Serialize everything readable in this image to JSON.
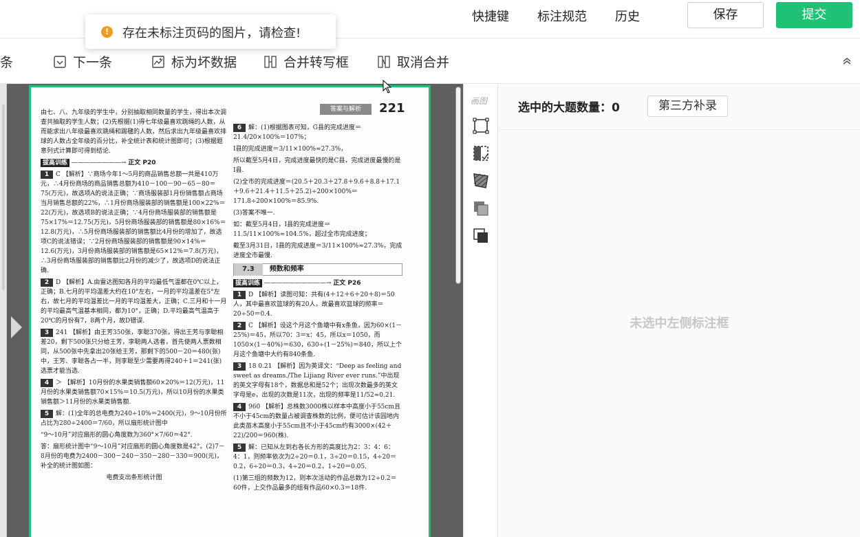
{
  "topbar": {
    "links": [
      "快捷键",
      "标注规范",
      "历史"
    ],
    "save_label": "保存",
    "submit_label": "提交",
    "accent": "#1fc274"
  },
  "toast": {
    "text": "存在未标注页码的图片，请检查!",
    "icon": "warning-icon",
    "color": "#f59a1b"
  },
  "toolbar": {
    "items": [
      {
        "label": "条",
        "icon": ""
      },
      {
        "label": "下一条",
        "icon": "checkbox-icon"
      },
      {
        "label": "标为坏数据",
        "icon": "image-bad-icon"
      },
      {
        "label": "合并转写框",
        "icon": "merge-icon"
      },
      {
        "label": "取消合并",
        "icon": "unmerge-icon"
      }
    ]
  },
  "document": {
    "header_tag": "答案与解析",
    "page_number": "221",
    "left_col": [
      "由七、八、九年级的学生中，分别抽取相同数量的学生，得出本次调查共抽取的学生人数；(2)先根据(1)得七年级最喜欢跳绳的人数，从而能求出八年级最喜欢跳绳和踢毽的人数，然后求出九年级最喜欢排球的人数占全年级的百分比，补全统计表和统计图即可；(3)根据题意列式计算即可得到结论."
    ],
    "section_tag": "拔高训练",
    "section_ref": "正文 P20",
    "items_left": [
      {
        "n": "1",
        "text": "C 【解析】∵商场今年1～5月的商品销售总额一共是410万元，∴4月份商场的商品销售总额为410－100－90－65－80＝75(万元)，故选项A的说法正确；∵商场服装部1月份销售额占商场当月销售总额的22%，∴1月份商场服装部的销售额是100×22%＝22(万元)，故选项B的说法正确；∵4月份商场服装部的销售额是75×17%＝12.75(万元)，5月份商场服装部的销售额是80×16%＝12.8(万元)，∴5月份商场服装部的销售额比4月份的增加了，故选项C的说法错误；∵2月份商场服装部的销售额是90×14%＝12.6(万元)，3月份商场服装部的销售额是65×12%＝7.8(万元)，∴3月份商场服装部的销售额比2月份的减少了，故选项D的说法正确."
      },
      {
        "n": "2",
        "text": "D 【解析】A.由雷达图知各月的平均最低气温都在0℃以上，正确；B.七月的平均温差大约在10°左右，一月的平均温差在5°左右，故七月的平均温差比一月的平均温差大，正确；C.三月和十一月的平均最高气温基本相同，都为10°，正确；D.平均最高气温高于20℃的月份有7，8两个月，故D错误."
      },
      {
        "n": "3",
        "text": "241 【解析】由王芳350张，李聪370张，得出王芳与李聪相差20，剩下500张只分给王芳，李聪两人选者，首先使两人票数相同，从500张中先拿出20张给王芳，那剩下的500－20＝480(张)中，王芳、李聪各占一半，则李聪至少需要再得240＋1＝241(张)选票才能当选."
      },
      {
        "n": "4",
        "text": "＞ 【解析】10月份的水果类销售额60×20%＝12(万元)，11月份的水果类销售额70×15%＝10.5(万元)，所以10月份的水果类销售额＞11月份的水果类销售额."
      },
      {
        "n": "5",
        "text": "解：(1)全年的总电费为240÷10%＝2400(元)，9～10月份所占比为280÷2400＝7/60，所以扇形统计图中"
      },
      {
        "n": "",
        "text": "“9～10月”对应扇形的圆心角度数为360°×7/60＝42°."
      },
      {
        "n": "",
        "text": "答：扇形统计图中“9～10月”对应扇形的圆心角度数是42°。(2)7－8月份的电费为2400－300－240－350－280－330＝900(元)，补全的统计图如图："
      },
      {
        "n": "",
        "text": "电费支出条形统计图"
      }
    ],
    "items_right": [
      {
        "n": "6",
        "text": "解：(1)根据图表可知，G县的完成进度＝21.4/20×100%＝107%；"
      },
      {
        "n": "",
        "text": "I县的完成进度＝3/11×100%≈27.3%，"
      },
      {
        "n": "",
        "text": "所以截至5月4日，完成进度最快的是C县，完成进度最慢的是I县."
      },
      {
        "n": "",
        "text": "(2)全市的完成进度＝(20.5＋20.3＋27.8＋9.6＋8.8＋17.1＋9.6＋21.4＋11.5＋25.2)÷200×100%＝171.8÷200×100%＝85.9%."
      },
      {
        "n": "",
        "text": "(3)答案不唯一."
      },
      {
        "n": "",
        "text": "如：截至5月4日，I县的完成进度＝11.5/11×100%≈104.5%，超过全市完成进度；"
      },
      {
        "n": "",
        "text": "截至3月31日，I县的完成进度＝3/11×100%≈27.3%，完成进度全市最慢."
      }
    ],
    "section2_num": "7.3",
    "section2_title": "频数和频率",
    "section2_tag": "拔高训练",
    "section2_ref": "正文 P26",
    "items_right2": [
      {
        "n": "1",
        "text": "D 【解析】读图可知：共有(4＋12＋6＋20＋8)＝50人，其中最喜欢篮球的有20人，故最喜欢篮球的频率＝20÷50＝0.4."
      },
      {
        "n": "2",
        "text": "C 【解析】设这个月这个鱼塘中有x条鱼，因为60×(1－25%)＝45，所以70：3＝x：45，所以x＝1050，而1050×(1－40%)＝630，630÷(1－25%)＝840，所以上个月这个鱼塘中大约有840条鱼."
      },
      {
        "n": "3",
        "text": "18 0.21 【解析】因为英译文：“Deep as feeling and sweet as dreams./The Lijiang River ever runs.”中出现的英文字母有18个，数据总和是52个；出现次数最多的英文字母是e，出现的次数是11次，出现的频率是11/52≈0.21."
      },
      {
        "n": "4",
        "text": "960 【解析】总株数3000株以样本中高度小于55cm且不小于45cm的数量占被调查株数的比例，便可估计该园地内此类苗木高度小于55cm且不小于45cm约有3000×(42＋22)/200＝960(株)."
      },
      {
        "n": "5",
        "text": "解：已知从左到右各长方形的高度比为2：3：4：6：4：1，则频率依次为2÷20＝0.1，3÷20＝0.15，4÷20＝0.2，6÷20＝0.3，4÷20＝0.2，1÷20＝0.05."
      },
      {
        "n": "",
        "text": "(1)第三组的频数为12，则本次活动的作品总数为12÷0.2＝60件，上交作品最多的组有作品60×0.3＝18件."
      }
    ]
  },
  "tools": {
    "label": "画图",
    "items": [
      "rect-select-icon",
      "half-rect-icon",
      "polygon-icon",
      "fill-layer-icon",
      "outline-layer-icon"
    ]
  },
  "right_panel": {
    "selected_label": "选中的大题数量：0",
    "third_party_button": "第三方补录",
    "empty_text": "未选中左侧标注框"
  }
}
